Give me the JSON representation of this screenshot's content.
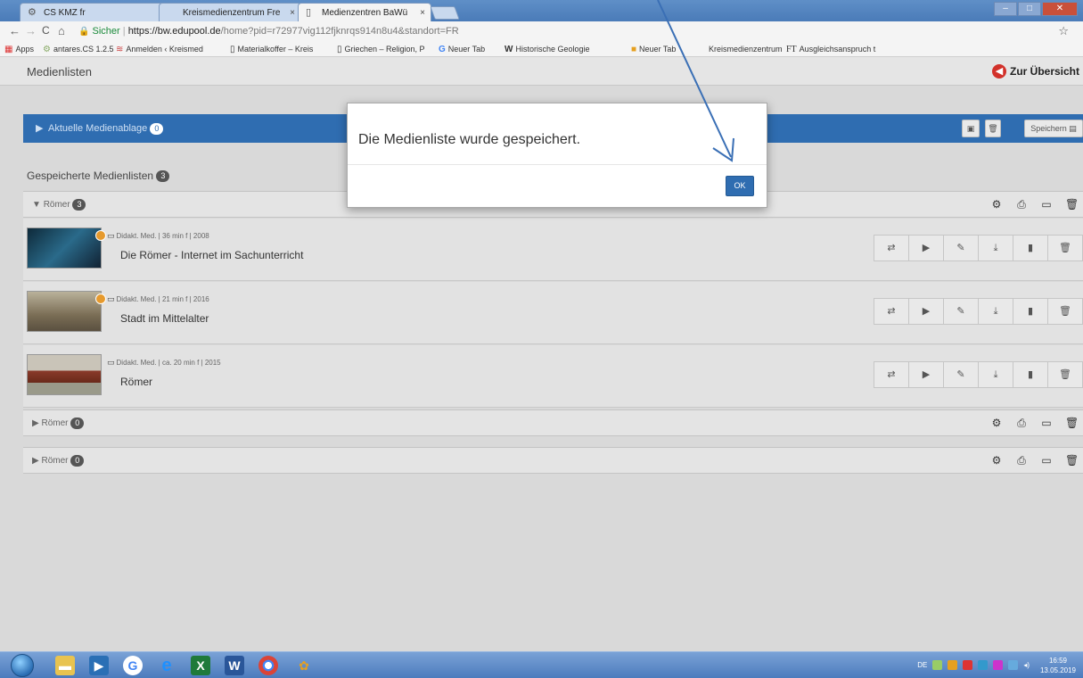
{
  "browser": {
    "tabs": [
      {
        "label": "CS KMZ fr",
        "icon": "gear-icon"
      },
      {
        "label": "Kreismedienzentrum Fre",
        "icon": "page-icon"
      },
      {
        "label": "Medienzentren BaWü",
        "icon": "page-icon"
      }
    ],
    "tab_close": "×",
    "window_controls": {
      "minimize": "–",
      "maximize": "□",
      "close": "✕"
    },
    "nav": {
      "back": "←",
      "forward": "→",
      "reload": "C",
      "home": "⌂"
    },
    "url": {
      "lock": "🔒",
      "secure_label": "Sicher",
      "divider": "|",
      "scheme_host": "https://bw.edupool.de",
      "path": "/home?pid=r72977vig112fjknrqs914n8u4&standort=FR"
    },
    "star": "☆",
    "bookmarks": [
      "Apps",
      "antares.CS 1.2.5",
      "Anmelden ‹ Kreismed",
      "Materialkoffer – Kreis",
      "Griechen – Religion, P",
      "Neuer Tab",
      "Historische Geologie",
      "Neuer Tab",
      "Kreismedienzentrum",
      "Ausgleichsanspruch t"
    ]
  },
  "page": {
    "title": "Medienlisten",
    "back_label": "Zur Übersicht",
    "current": {
      "label": "Aktuelle Medienablage",
      "count": "0",
      "save_label": "Speichern"
    },
    "saved_title": "Gespeicherte Medienlisten",
    "saved_count": "3",
    "groups": [
      {
        "name": "Römer",
        "count": "3",
        "expanded": true,
        "caret": "▼"
      },
      {
        "name": "Römer",
        "count": "0",
        "expanded": false,
        "caret": "▶"
      },
      {
        "name": "Römer",
        "count": "0",
        "expanded": false,
        "caret": "▶"
      }
    ],
    "items": [
      {
        "meta": "Didakt. Med. | 36 min f | 2008",
        "title": "Die Römer - Internet im Sachunterricht"
      },
      {
        "meta": "Didakt. Med. | 21 min f | 2016",
        "title": "Stadt im Mittelalter"
      },
      {
        "meta": "Didakt. Med. | ca. 20 min f | 2015",
        "title": "Römer"
      }
    ]
  },
  "modal": {
    "message": "Die Medienliste wurde gespeichert.",
    "ok_label": "OK"
  },
  "taskbar": {
    "language": "DE",
    "time": "16:59",
    "date": "13.05.2019"
  },
  "colors": {
    "accent_blue": "#2f6db1",
    "back_red": "#d2312a",
    "annotation_arrow": "#3a6fb5"
  }
}
